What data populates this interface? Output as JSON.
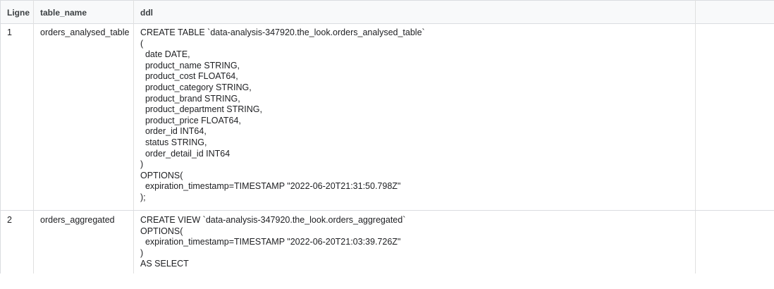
{
  "columns": {
    "line": "Ligne",
    "table_name": "table_name",
    "ddl": "ddl"
  },
  "rows": [
    {
      "line": "1",
      "table_name": "orders_analysed_table",
      "ddl": "CREATE TABLE `data-analysis-347920.the_look.orders_analysed_table`\n(\n  date DATE,\n  product_name STRING,\n  product_cost FLOAT64,\n  product_category STRING,\n  product_brand STRING,\n  product_department STRING,\n  product_price FLOAT64,\n  order_id INT64,\n  status STRING,\n  order_detail_id INT64\n)\nOPTIONS(\n  expiration_timestamp=TIMESTAMP \"2022-06-20T21:31:50.798Z\"\n);"
    },
    {
      "line": "2",
      "table_name": "orders_aggregated",
      "ddl": "CREATE VIEW `data-analysis-347920.the_look.orders_aggregated`\nOPTIONS(\n  expiration_timestamp=TIMESTAMP \"2022-06-20T21:03:39.726Z\"\n)\nAS SELECT"
    }
  ]
}
